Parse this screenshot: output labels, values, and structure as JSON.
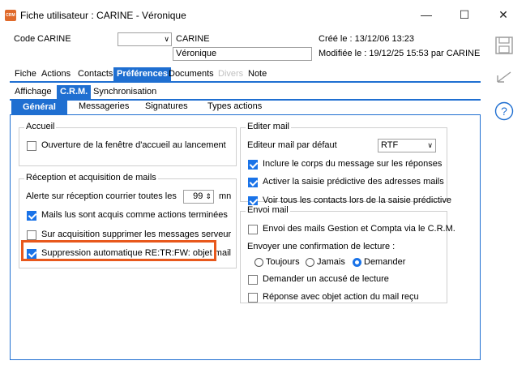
{
  "window": {
    "title": "Fiche utilisateur : CARINE - Véronique",
    "app_icon_text": "CRM",
    "minimize": "—",
    "maximize": "☐",
    "close": "✕"
  },
  "header": {
    "code_label": "Code",
    "code_value": "CARINE",
    "combo_value": "",
    "last_name": "CARINE",
    "first_name": "Véronique",
    "created": "Créé le : 13/12/06 13:23",
    "modified": "Modifiée le : 19/12/25 15:53 par CARINE"
  },
  "tabs_main": [
    "Fiche",
    "Actions",
    "Contacts",
    "Préférences",
    "Documents",
    "Divers",
    "Note"
  ],
  "tabs_sub": [
    "Affichage",
    "C.R.M.",
    "Synchronisation"
  ],
  "tabs_crm": [
    "Général",
    "Messageries",
    "Signatures",
    "Types actions"
  ],
  "accueil": {
    "title": "Accueil",
    "open_window": "Ouverture de la fenêtre d'accueil au lancement"
  },
  "reception": {
    "title": "Réception et acquisition de mails",
    "alert_label": "Alerte sur réception courrier toutes les",
    "alert_value": "99",
    "alert_unit": "mn",
    "mails_read": "Mails lus sont acquis comme actions terminées",
    "delete_server": "Sur acquisition supprimer les messages serveur",
    "auto_delete": "Suppression automatique RE:TR:FW: objet mail"
  },
  "editer": {
    "title": "Editer mail",
    "editor_label": "Editeur mail par défaut",
    "editor_value": "RTF",
    "include_body": "Inclure le corps du message sur les réponses",
    "predictive": "Activer la saisie prédictive des adresses mails",
    "all_contacts": "Voir tous les contacts lors de la saisie prédictive"
  },
  "envoi": {
    "title": "Envoi mail",
    "send_gc": "Envoi des mails Gestion et Compta via le C.R.M.",
    "confirm_label": "Envoyer une confirmation de lecture :",
    "opt_always": "Toujours",
    "opt_never": "Jamais",
    "opt_ask": "Demander",
    "ack": "Demander un accusé de lecture",
    "reply_subject": "Réponse avec objet action du mail reçu"
  },
  "colors": {
    "accent": "#1f6fd1",
    "highlight": "#e8581c",
    "check": "#1a73e8"
  }
}
